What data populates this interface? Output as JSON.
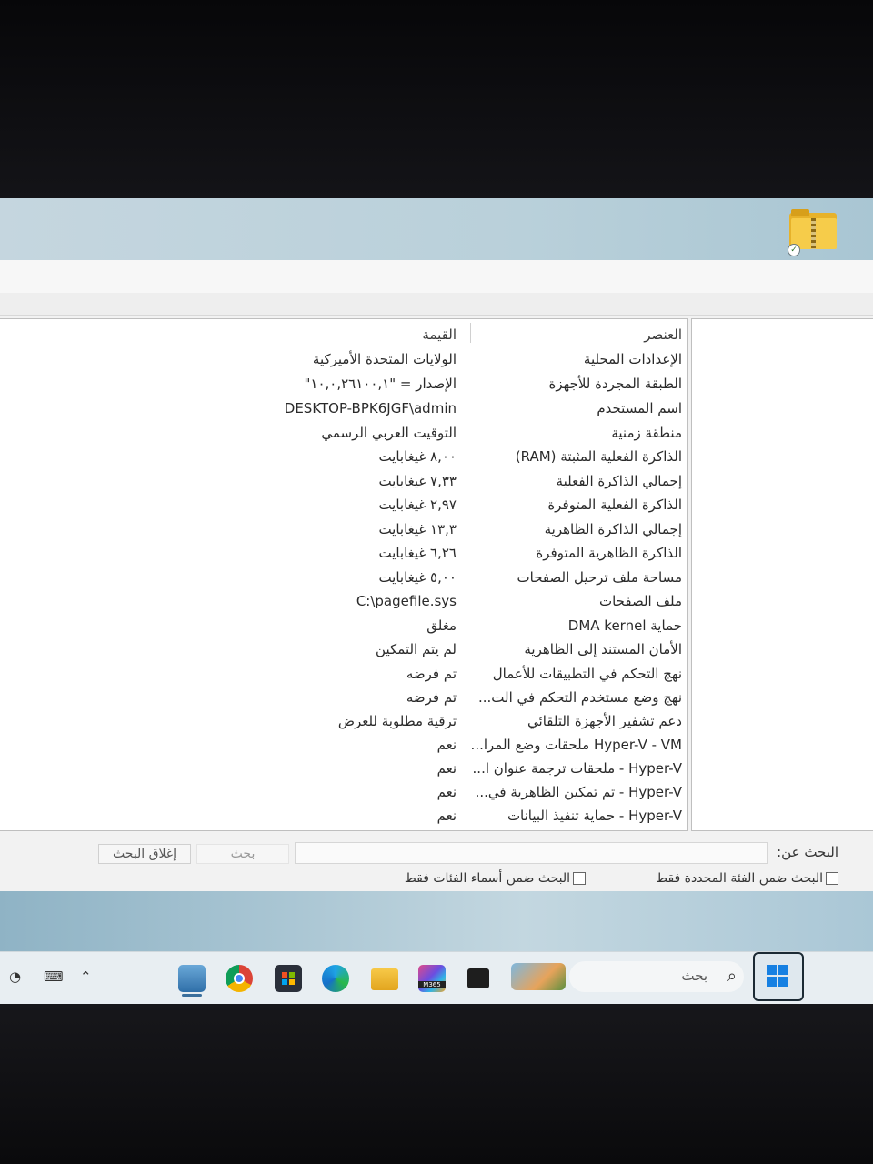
{
  "window": {
    "columns": {
      "item": "العنصر",
      "value": "القيمة"
    },
    "rows": [
      {
        "item": "الإعدادات المحلية",
        "value": "الولايات المتحدة الأميركية"
      },
      {
        "item": "الطبقة المجردة للأجهزة",
        "value": "الإصدار = \"١٠,٠,٢٦١٠٠,١\""
      },
      {
        "item": "اسم المستخدم",
        "value": "DESKTOP-BPK6JGF\\admin"
      },
      {
        "item": "منطقة زمنية",
        "value": "التوقيت العربي الرسمي"
      },
      {
        "item": "الذاكرة الفعلية المثبتة (RAM)",
        "value": "٨,٠٠ غيغابايت"
      },
      {
        "item": "إجمالي الذاكرة الفعلية",
        "value": "٧,٣٣ غيغابايت"
      },
      {
        "item": "الذاكرة الفعلية المتوفرة",
        "value": "٢,٩٧ غيغابايت"
      },
      {
        "item": "إجمالي الذاكرة الظاهرية",
        "value": "١٣,٣ غيغابايت"
      },
      {
        "item": "الذاكرة الظاهرية المتوفرة",
        "value": "٦,٢٦ غيغابايت"
      },
      {
        "item": "مساحة ملف ترحيل الصفحات",
        "value": "٥,٠٠ غيغابايت"
      },
      {
        "item": "ملف الصفحات",
        "value": "C:\\pagefile.sys"
      },
      {
        "item": "حماية DMA kernel",
        "value": "مغلق"
      },
      {
        "item": "الأمان المستند إلى الظاهرية",
        "value": "لم يتم التمكين"
      },
      {
        "item": "نهج التحكم في التطبيقات للأعمال",
        "value": "تم فرضه"
      },
      {
        "item": "نهج وضع مستخدم التحكم في الت...",
        "value": "تم فرضه"
      },
      {
        "item": "دعم تشفير الأجهزة التلقائي",
        "value": "ترقية مطلوبة للعرض"
      },
      {
        "item": "Hyper-V - VM ملحقات وضع المرا...",
        "value": "نعم"
      },
      {
        "item": "Hyper-V - ملحقات ترجمة عنوان ا...",
        "value": "نعم"
      },
      {
        "item": "Hyper-V - تم تمكين الظاهرية في...",
        "value": "نعم"
      },
      {
        "item": "Hyper-V - حماية تنفيذ البيانات",
        "value": "نعم"
      }
    ]
  },
  "search": {
    "label": "البحث عن:",
    "find_button": "بحث",
    "close_button": "إغلاق البحث",
    "check_selected_category": "البحث ضمن الفئة المحددة فقط",
    "check_category_names": "البحث ضمن أسماء الفئات فقط"
  },
  "taskbar": {
    "search_placeholder": "بحث",
    "icons": [
      "windows-start-icon",
      "search-icon",
      "widget-icon",
      "terminal-icon",
      "m365-icon",
      "file-explorer-icon",
      "edge-icon",
      "store-icon",
      "chrome-icon",
      "system-info-icon"
    ],
    "m365_label": "M365"
  }
}
